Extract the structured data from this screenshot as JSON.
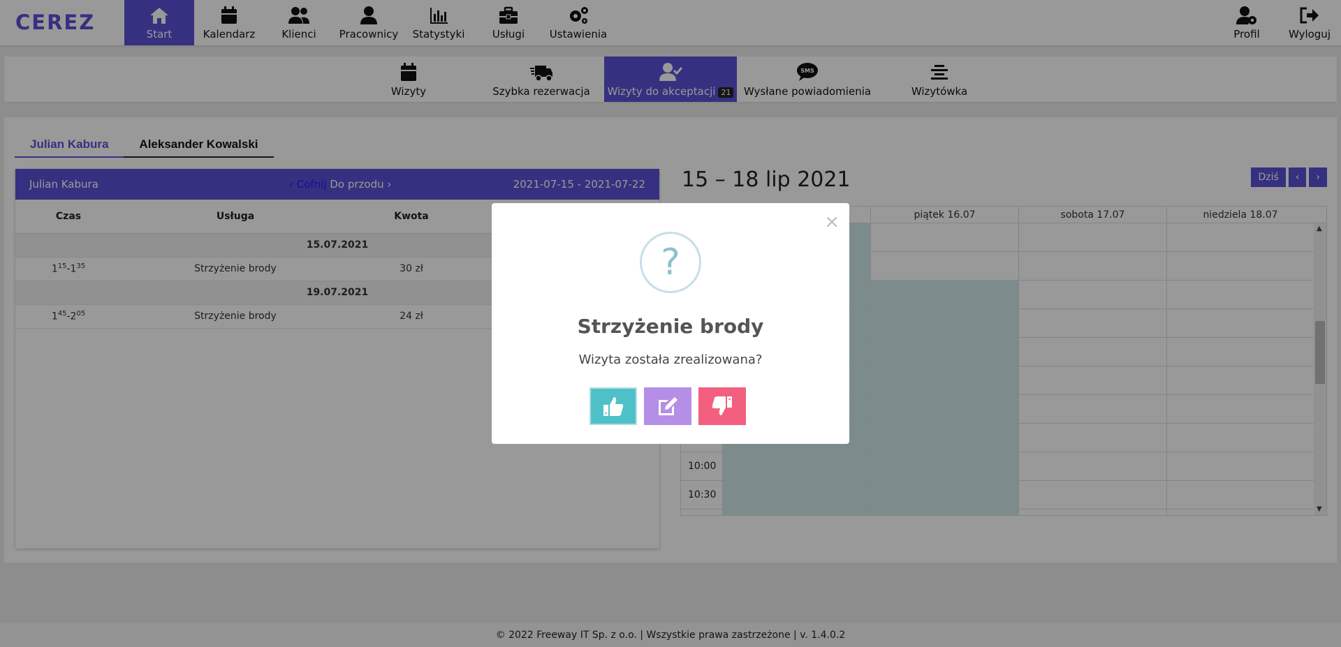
{
  "brand": {
    "logo_text": "CEREZ"
  },
  "topnav": {
    "items": [
      {
        "label": "Start",
        "icon": "home-icon",
        "active": true
      },
      {
        "label": "Kalendarz",
        "icon": "calendar-icon"
      },
      {
        "label": "Klienci",
        "icon": "users-icon"
      },
      {
        "label": "Pracownicy",
        "icon": "user-icon"
      },
      {
        "label": "Statystyki",
        "icon": "bar-chart-icon"
      },
      {
        "label": "Usługi",
        "icon": "toolbox-icon"
      },
      {
        "label": "Ustawienia",
        "icon": "gears-icon"
      }
    ],
    "profile_label": "Profil",
    "logout_label": "Wyloguj"
  },
  "subnav": {
    "items": [
      {
        "label": "Wizyty",
        "icon": "calendar-icon"
      },
      {
        "label": "Szybka rezerwacja",
        "icon": "truck-fast-icon"
      },
      {
        "label": "Wizyty do akceptacji",
        "icon": "user-check-icon",
        "badge": "21",
        "active": true
      },
      {
        "label": "Wysłane powiadomienia",
        "icon": "sms-bubble-icon"
      },
      {
        "label": "Wizytówka",
        "icon": "align-center-icon"
      }
    ]
  },
  "tabs": [
    {
      "label": "Julian Kabura",
      "active": true
    },
    {
      "label": "Aleksander Kowalski"
    }
  ],
  "list": {
    "employee": "Julian Kabura",
    "back_label": "Cofnij",
    "forward_label": "Do przodu",
    "range": "2021-07-15 - 2021-07-22",
    "columns": [
      "Czas",
      "Usługa",
      "Kwota"
    ],
    "groups": [
      {
        "date": "15.07.2021",
        "rows": [
          {
            "start_h": "1",
            "start_m": "15",
            "end_h": "1",
            "end_m": "35",
            "service": "Strzyżenie brody",
            "amount": "30 zł"
          }
        ]
      },
      {
        "date": "19.07.2021",
        "rows": [
          {
            "start_h": "1",
            "start_m": "45",
            "end_h": "2",
            "end_m": "05",
            "service": "Strzyżenie brody",
            "amount": "24 zł"
          }
        ]
      }
    ]
  },
  "calendar": {
    "title": "15 – 18 lip 2021",
    "today_label": "Dziś",
    "days": [
      "piątek 16.07",
      "sobota 17.07",
      "niedziela 18.07"
    ],
    "time_labels": [
      "10:00",
      "10:30"
    ]
  },
  "footer": {
    "text": "© 2022 Freeway IT Sp. z o.o. | Wszystkie prawa zastrzeżone | v. 1.4.0.2"
  },
  "modal": {
    "icon_glyph": "?",
    "title": "Strzyżenie brody",
    "question": "Wizyta została zrealizowana?",
    "close_glyph": "×"
  },
  "colors": {
    "accent": "#5b50d6",
    "confirm": "#4ec1c8",
    "edit": "#b58ee6",
    "reject": "#f3607f",
    "available": "#cfe9ec"
  }
}
